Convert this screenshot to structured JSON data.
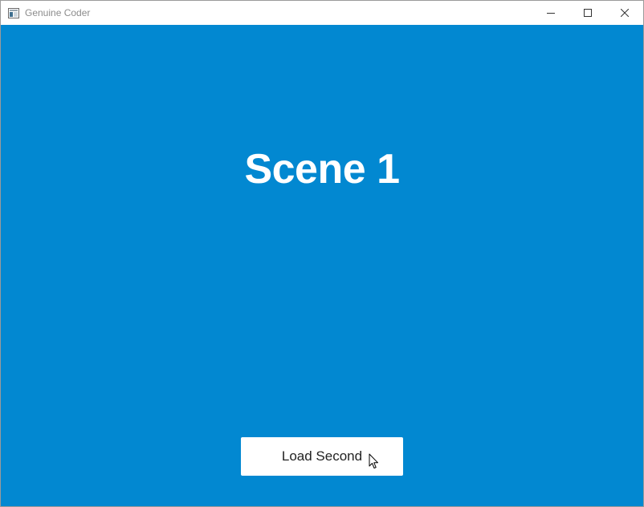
{
  "window": {
    "title": "Genuine Coder",
    "icon": "app-window-icon",
    "controls": [
      "minimize-icon",
      "maximize-icon",
      "close-icon"
    ]
  },
  "scene": {
    "title": "Scene 1",
    "background_color": "#0288d1"
  },
  "buttons": {
    "load_second_label": "Load Second"
  },
  "cursor": {
    "icon": "mouse-pointer-icon"
  }
}
